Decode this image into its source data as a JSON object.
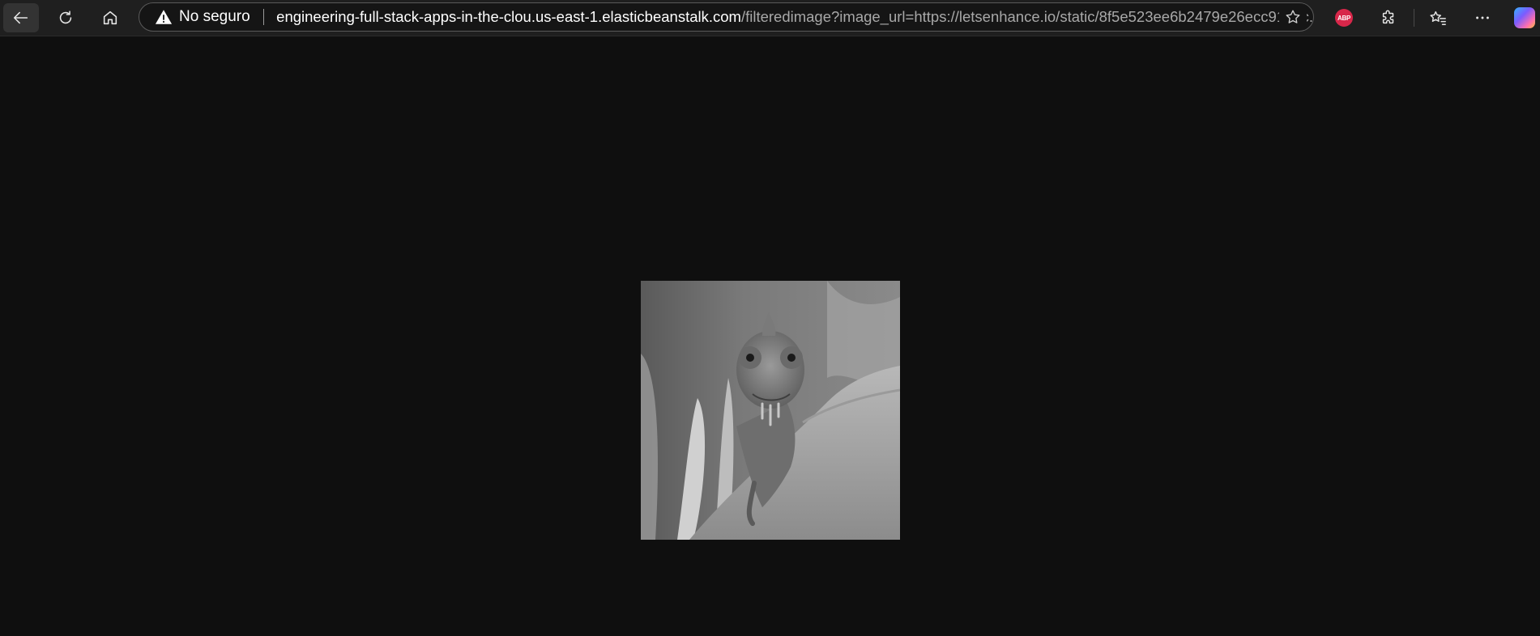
{
  "browser": {
    "security_label": "No seguro",
    "url_host": "engineering-full-stack-apps-in-the-clou.us-east-1.elasticbeanstalk.com",
    "url_path": "/filteredimage?image_url=https://letsenhance.io/static/8f5e523ee6b2479e26ecc91b9c...",
    "extension_abp_label": "ABP",
    "icons": {
      "back": "back-arrow-icon",
      "reload": "reload-icon",
      "home": "home-icon",
      "warning": "warning-triangle-icon",
      "favorite": "star-icon",
      "extensions": "puzzle-icon",
      "favorites": "favorites-list-icon",
      "menu": "more-dots-icon",
      "copilot": "copilot-icon"
    }
  },
  "page": {
    "background": "#0f0f0f",
    "image": {
      "subject": "grayscale chameleon on a leaf",
      "filter": "grayscale"
    }
  }
}
